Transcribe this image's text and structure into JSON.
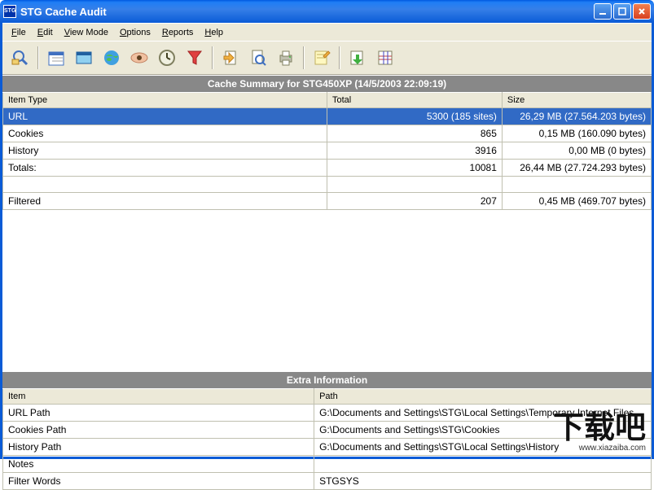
{
  "window": {
    "title": "STG Cache Audit",
    "icon_text": "STG"
  },
  "menu": [
    "File",
    "Edit",
    "View Mode",
    "Options",
    "Reports",
    "Help"
  ],
  "toolbar": [
    "search-zoom-icon",
    "|",
    "calendar-icon",
    "window-icon",
    "globe-icon",
    "eye-icon",
    "clock-icon",
    "funnel-icon",
    "|",
    "export-icon",
    "zoom-page-icon",
    "print-icon",
    "|",
    "edit-note-icon",
    "|",
    "sheet-arrow-icon",
    "sheet-grid-icon"
  ],
  "summary": {
    "title": "Cache Summary for STG450XP (14/5/2003 22:09:19)",
    "columns": [
      "Item Type",
      "Total",
      "Size"
    ],
    "rows": [
      {
        "type": "URL",
        "total": "5300 (185 sites)",
        "size": "26,29 MB (27.564.203 bytes)",
        "selected": true
      },
      {
        "type": "Cookies",
        "total": "865",
        "size": "0,15 MB (160.090 bytes)",
        "selected": false
      },
      {
        "type": "History",
        "total": "3916",
        "size": "0,00 MB (0 bytes)",
        "selected": false
      },
      {
        "type": "Totals:",
        "total": "10081",
        "size": "26,44 MB (27.724.293 bytes)",
        "selected": false
      },
      {
        "type": "",
        "total": "",
        "size": "",
        "selected": false
      },
      {
        "type": "Filtered",
        "total": "207",
        "size": "0,45 MB (469.707 bytes)",
        "selected": false
      }
    ]
  },
  "extra": {
    "title": "Extra Information",
    "columns": [
      "Item",
      "Path"
    ],
    "rows": [
      {
        "item": "URL Path",
        "path": "G:\\Documents and Settings\\STG\\Local Settings\\Temporary Internet Files"
      },
      {
        "item": "Cookies Path",
        "path": "G:\\Documents and Settings\\STG\\Cookies"
      },
      {
        "item": "History Path",
        "path": "G:\\Documents and Settings\\STG\\Local Settings\\History"
      },
      {
        "item": "Notes",
        "path": ""
      },
      {
        "item": "Filter Words",
        "path": "STGSYS"
      }
    ]
  },
  "watermark": {
    "logo": "下载吧",
    "url": "www.xiazaiba.com"
  }
}
